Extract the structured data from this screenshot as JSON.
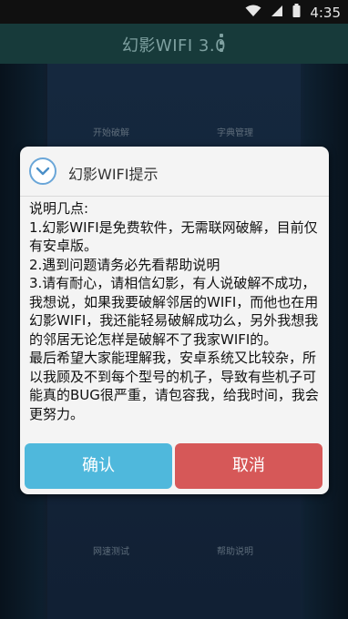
{
  "status_bar": {
    "time": "4:35"
  },
  "app_bar": {
    "title": "幻影WIFI 3.0"
  },
  "background_menu": {
    "top_left": "开始破解",
    "top_right": "字典管理",
    "bottom_left": "网速测试",
    "bottom_right": "帮助说明"
  },
  "dialog": {
    "title": "幻影WIFI提示",
    "body": [
      "说明几点:",
      "1.幻影WIFI是免费软件，无需联网破解，目前仅有安卓版。",
      "2.遇到问题请务必先看帮助说明",
      "3.请有耐心，请相信幻影，有人说破解不成功，我想说，如果我要破解邻居的WIFI，而他也在用幻影WIFI，我还能轻易破解成功么，另外我想我的邻居无论怎样是破解不了我家WIFI的。",
      "最后希望大家能理解我，安卓系统又比较杂，所以我顾及不到每个型号的机子，导致有些机子可能真的BUG很严重，请包容我，给我时间，我会更努力。"
    ],
    "confirm_label": "确认",
    "cancel_label": "取消"
  },
  "colors": {
    "confirm": "#4fb8dc",
    "cancel": "#d65858",
    "app_bar": "#173a3a"
  },
  "icons": [
    "wifi-icon",
    "signal-icon",
    "battery-icon",
    "more-vert-icon",
    "chevron-down-icon"
  ]
}
